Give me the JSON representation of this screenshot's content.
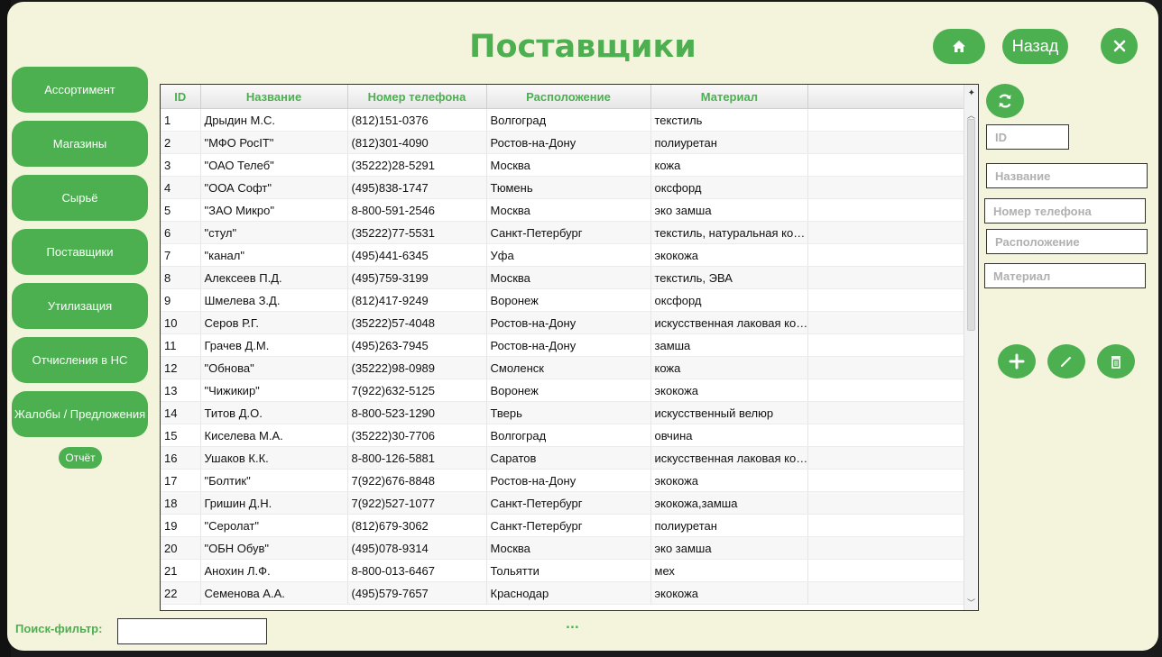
{
  "title": "Поставщики",
  "header": {
    "back_label": "Назад",
    "home_icon": "home-icon",
    "close_icon": "close-icon"
  },
  "sidebar": {
    "items": [
      {
        "label": "Ассортимент"
      },
      {
        "label": "Магазины"
      },
      {
        "label": "Сырьё"
      },
      {
        "label": "Поставщики"
      },
      {
        "label": "Утилизация"
      },
      {
        "label": "Отчисления в НС"
      },
      {
        "label": "Жалобы / Предложения"
      }
    ],
    "report_label": "Отчёт"
  },
  "table": {
    "columns": [
      "ID",
      "Название",
      "Номер телефона",
      "Расположение",
      "Материал"
    ],
    "rows": [
      [
        "1",
        "Дрыдин М.С.",
        "(812)151-0376",
        "Волгоград",
        "текстиль"
      ],
      [
        "2",
        "\"МФО РосIT\"",
        "(812)301-4090",
        "Ростов-на-Дону",
        "полиуретан"
      ],
      [
        "3",
        "\"ОАО Телеб\"",
        "(35222)28-5291",
        "Москва",
        "кожа"
      ],
      [
        "4",
        "\"ООА Софт\"",
        "(495)838-1747",
        "Тюмень",
        "оксфорд"
      ],
      [
        "5",
        "\"ЗАО Микро\"",
        "8-800-591-2546",
        "Москва",
        "эко замша"
      ],
      [
        "6",
        "\"стул\"",
        "(35222)77-5531",
        "Санкт-Петербург",
        "текстиль, натуральная ко…"
      ],
      [
        "7",
        "\"канал\"",
        "(495)441-6345",
        "Уфа",
        "экокожа"
      ],
      [
        "8",
        "Алексеев П.Д.",
        "(495)759-3199",
        "Москва",
        "текстиль, ЭВА"
      ],
      [
        "9",
        "Шмелева З.Д.",
        "(812)417-9249",
        "Воронеж",
        "оксфорд"
      ],
      [
        "10",
        "Серов Р.Г.",
        "(35222)57-4048",
        "Ростов-на-Дону",
        "искусственная лаковая ко…"
      ],
      [
        "11",
        "Грачев Д.М.",
        "(495)263-7945",
        "Ростов-на-Дону",
        "замша"
      ],
      [
        "12",
        "\"Обнова\"",
        "(35222)98-0989",
        "Смоленск",
        "кожа"
      ],
      [
        "13",
        "\"Чижикир\"",
        "7(922)632-5125",
        "Воронеж",
        "экокожа"
      ],
      [
        "14",
        "Титов Д.О.",
        "8-800-523-1290",
        "Тверь",
        "искусственный велюр"
      ],
      [
        "15",
        "Киселева М.А.",
        "(35222)30-7706",
        "Волгоград",
        "овчина"
      ],
      [
        "16",
        "Ушаков К.К.",
        "8-800-126-5881",
        "Саратов",
        "искусственная лаковая ко…"
      ],
      [
        "17",
        "\"Болтик\"",
        "7(922)676-8848",
        "Ростов-на-Дону",
        "экокожа"
      ],
      [
        "18",
        "Гришин Д.Н.",
        "7(922)527-1077",
        "Санкт-Петербург",
        "экокожа,замша"
      ],
      [
        "19",
        "\"Серолат\"",
        "(812)679-3062",
        "Санкт-Петербург",
        "полиуретан"
      ],
      [
        "20",
        "\"ОБН Обув\"",
        "(495)078-9314",
        "Москва",
        "эко замша"
      ],
      [
        "21",
        "Анохин Л.Ф.",
        "8-800-013-6467",
        "Тольятти",
        "мех"
      ],
      [
        "22",
        "Семенова А.А.",
        "(495)579-7657",
        "Краснодар",
        "экокожа"
      ]
    ]
  },
  "form": {
    "id_placeholder": "ID",
    "name_placeholder": "Название",
    "phone_placeholder": "Номер телефона",
    "location_placeholder": "Расположение",
    "material_placeholder": "Материал"
  },
  "filter": {
    "label": "Поиск-фильтр:",
    "value": "",
    "status": "..."
  },
  "colors": {
    "accent": "#4caf50",
    "background": "#f4f4dc"
  }
}
